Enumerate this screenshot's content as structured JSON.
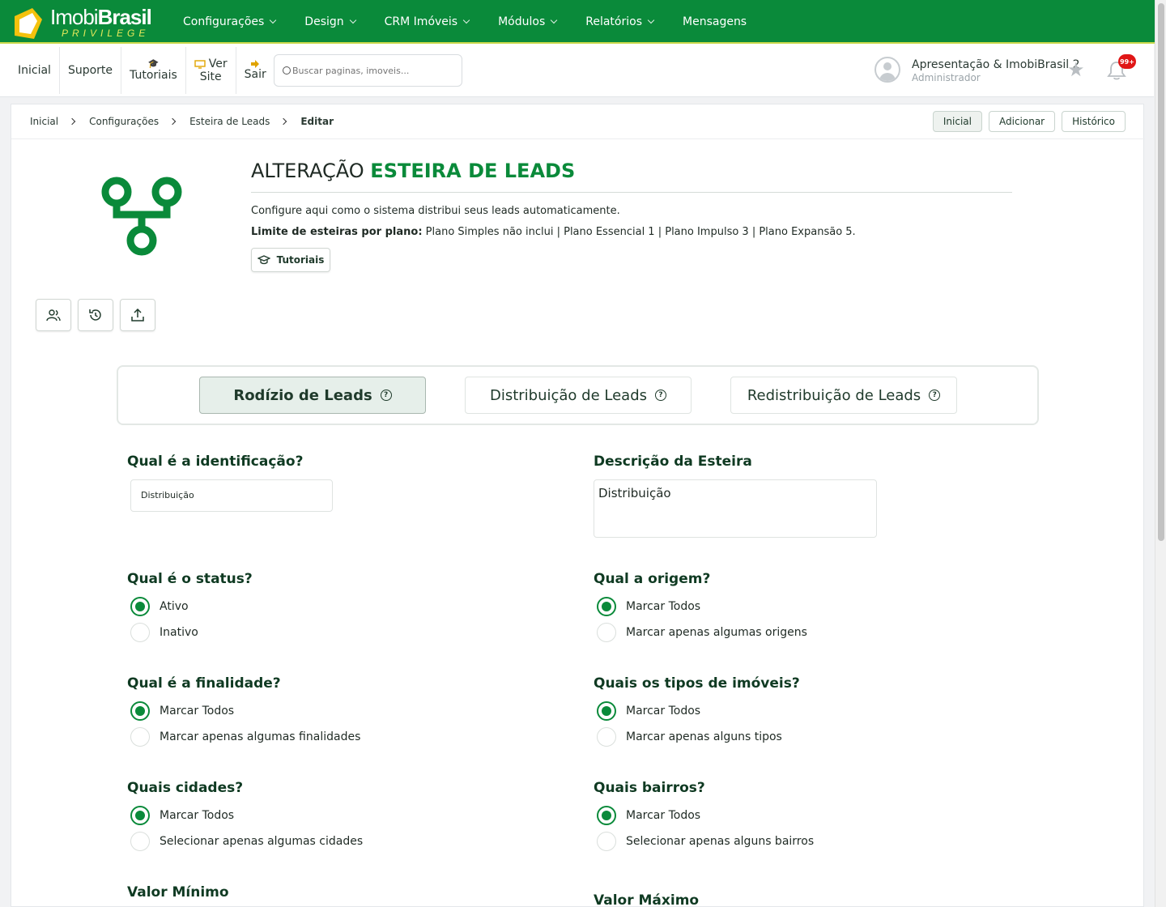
{
  "brand": {
    "name_light": "Imobi",
    "name_bold": "Brasil",
    "tagline": "PRIVILEGE"
  },
  "topnav": {
    "items": [
      {
        "label": "Configurações",
        "dropdown": true
      },
      {
        "label": "Design",
        "dropdown": true
      },
      {
        "label": "CRM Imóveis",
        "dropdown": true
      },
      {
        "label": "Módulos",
        "dropdown": true
      },
      {
        "label": "Relatórios",
        "dropdown": true
      },
      {
        "label": "Mensagens",
        "dropdown": false
      }
    ]
  },
  "subbar": {
    "inicial": "Inicial",
    "suporte": "Suporte",
    "tutoriais": "Tutoriais",
    "ver": "Ver",
    "site": "Site",
    "sair": "Sair",
    "search_placeholder": "Buscar paginas, imoveis..."
  },
  "user": {
    "name": "Apresentação & ImobiBrasil 2",
    "role": "Administrador",
    "notifications": "99+"
  },
  "breadcrumb": {
    "b1": "Inicial",
    "b2": "Configurações",
    "b3": "Esteira de Leads",
    "b4": "Editar"
  },
  "crumb_buttons": {
    "inicial": "Inicial",
    "adicionar": "Adicionar",
    "historico": "Histórico"
  },
  "header": {
    "title_prefix": "ALTERAÇÃO",
    "title_main": "ESTEIRA DE LEADS",
    "description": "Configure aqui como o sistema distribui seus leads automaticamente.",
    "limit_label": "Limite de esteiras por plano:",
    "limit_text": " Plano Simples não inclui | Plano Essencial 1 | Plano Impulso 3 | Plano Expansão 5.",
    "tutoriais_btn": "Tutoriais"
  },
  "tabs": {
    "t1": "Rodízio de Leads",
    "t2": "Distribuição de Leads",
    "t3": "Redistribuição de Leads",
    "help": "?"
  },
  "form": {
    "identificacao_label": "Qual é a identificação?",
    "identificacao_value": "Distribuição",
    "descricao_label": "Descrição da Esteira",
    "descricao_value": "Distribuição",
    "status_label": "Qual é o status?",
    "status_opt1": "Ativo",
    "status_opt2": "Inativo",
    "origem_label": "Qual a origem?",
    "origem_opt1": "Marcar Todos",
    "origem_opt2": "Marcar apenas algumas origens",
    "finalidade_label": "Qual é a finalidade?",
    "finalidade_opt1": "Marcar Todos",
    "finalidade_opt2": "Marcar apenas algumas finalidades",
    "tipos_label": "Quais os tipos de imóveis?",
    "tipos_opt1": "Marcar Todos",
    "tipos_opt2": "Marcar apenas alguns tipos",
    "cidades_label": "Quais cidades?",
    "cidades_opt1": "Marcar Todos",
    "cidades_opt2": "Selecionar apenas algumas cidades",
    "bairros_label": "Quais bairros?",
    "bairros_opt1": "Marcar Todos",
    "bairros_opt2": "Selecionar apenas alguns bairros",
    "valor_min_label": "Valor Mínimo",
    "valor_max_label": "Valor Máximo"
  },
  "colors": {
    "brand_green": "#0a8a3a",
    "accent_yellow": "#c9d84a",
    "badge_red": "#e01616"
  }
}
